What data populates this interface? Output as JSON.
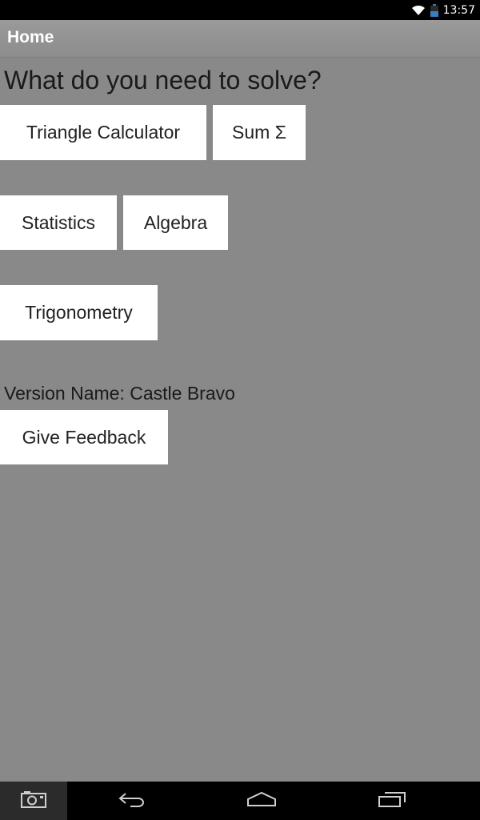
{
  "status_bar": {
    "time": "13:57",
    "icons": [
      "wifi-icon",
      "battery-icon"
    ]
  },
  "action_bar": {
    "title": "Home"
  },
  "main": {
    "heading": "What do you need to solve?",
    "buttons": {
      "triangle": "Triangle Calculator",
      "sum": "Sum Σ",
      "statistics": "Statistics",
      "algebra": "Algebra",
      "trigonometry": "Trigonometry",
      "feedback": "Give Feedback"
    },
    "version": "Version Name: Castle Bravo"
  },
  "nav_bar": {
    "icons": [
      "camera-icon",
      "back-icon",
      "home-icon",
      "recent-apps-icon"
    ]
  },
  "colors": {
    "background": "#898989",
    "button": "#ffffff",
    "text": "#1a1a1a",
    "bars": "#000000"
  }
}
